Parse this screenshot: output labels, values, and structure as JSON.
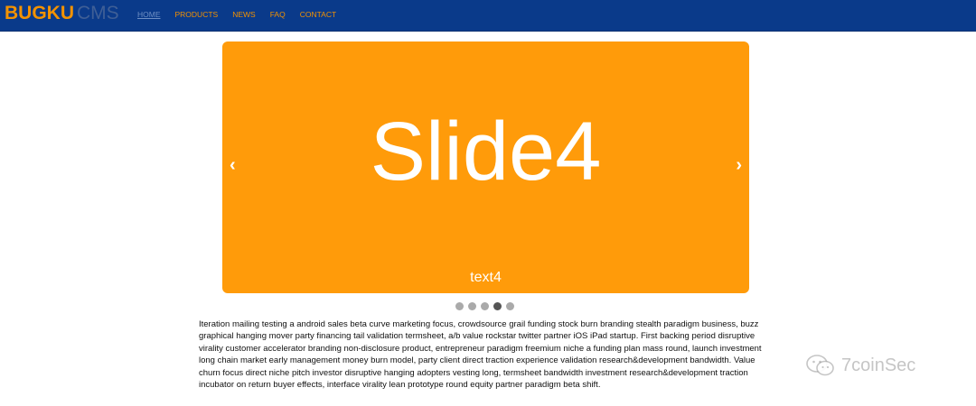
{
  "brand": {
    "bold": "BUGKU",
    "light": "CMS"
  },
  "nav": {
    "items": [
      {
        "label": "HOME",
        "active": true
      },
      {
        "label": "PRODUCTS",
        "active": false
      },
      {
        "label": "NEWS",
        "active": false
      },
      {
        "label": "FAQ",
        "active": false
      },
      {
        "label": "CONTACT",
        "active": false
      }
    ]
  },
  "carousel": {
    "title": "Slide4",
    "caption": "text4",
    "prev_icon": "‹",
    "next_icon": "›",
    "slide_count": 5,
    "active_index": 4,
    "background": "#ff9b0a"
  },
  "content": {
    "paragraph": "Iteration mailing testing a android sales beta curve marketing focus, crowdsource grail funding stock burn branding stealth paradigm business, buzz graphical hanging mover party financing tail validation termsheet, a/b value rockstar twitter partner iOS iPad startup. First backing period disruptive virality customer accelerator branding non-disclosure product, entrepreneur paradigm freemium niche a funding plan mass round, launch investment long chain market early management money burn model, party client direct traction experience validation research&development bandwidth. Value churn focus direct niche pitch investor disruptive hanging adopters vesting long, termsheet bandwidth investment research&development traction incubator on return buyer effects, interface virality lean prototype round equity partner paradigm beta shift."
  },
  "watermark": {
    "text": "7coinSec",
    "icon": "wechat-icon"
  },
  "colors": {
    "navbar": "#0a3a8a",
    "accent": "#f39200",
    "slide": "#ff9b0a"
  }
}
